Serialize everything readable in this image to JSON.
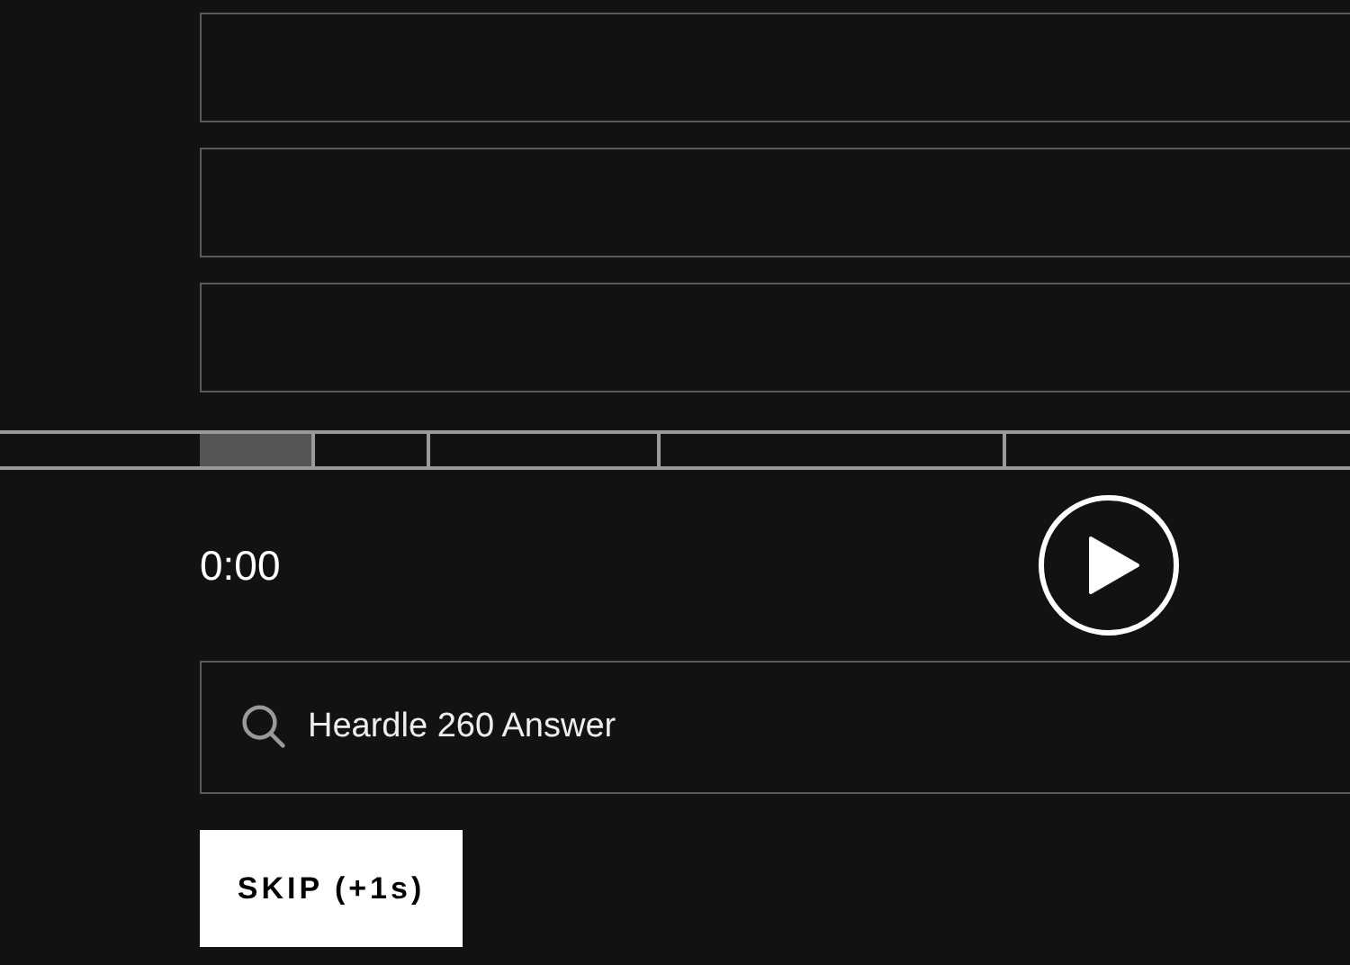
{
  "guesses": [
    {
      "filled": false
    },
    {
      "filled": false
    },
    {
      "filled": false
    }
  ],
  "player": {
    "time": "0:00",
    "playing": false
  },
  "search": {
    "value": "Heardle 260 Answer"
  },
  "skip_button": {
    "label": "SKIP (+1s)"
  }
}
